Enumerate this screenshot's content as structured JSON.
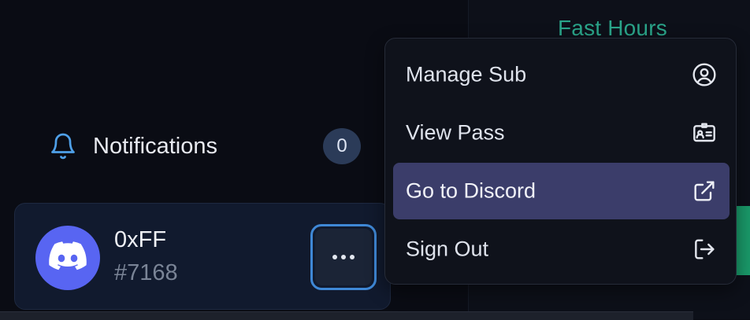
{
  "header": {
    "title": "Fast Hours"
  },
  "notifications": {
    "label": "Notifications",
    "count": "0",
    "icon": "bell-icon"
  },
  "user": {
    "name": "0xFF",
    "discriminator": "#7168",
    "avatar_icon": "discord-logo-icon",
    "more_icon": "more-horizontal-icon"
  },
  "menu": {
    "items": [
      {
        "label": "Manage Sub",
        "icon": "user-circle-icon"
      },
      {
        "label": "View Pass",
        "icon": "id-card-icon"
      },
      {
        "label": "Go to Discord",
        "icon": "external-link-icon",
        "highlighted": true
      },
      {
        "label": "Sign Out",
        "icon": "sign-out-icon"
      }
    ]
  },
  "colors": {
    "accent_teal": "#2aa58a",
    "menu_highlight": "#3b3d6a",
    "discord_blurple": "#5865f2",
    "focus_ring": "#3f88d6",
    "badge_bg": "#2b3b58"
  }
}
